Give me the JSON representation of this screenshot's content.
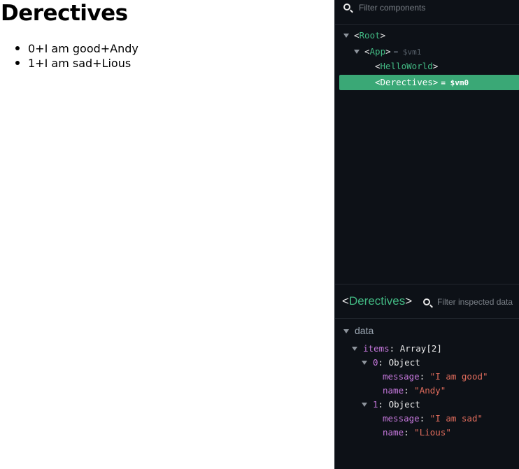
{
  "app": {
    "heading": "Derectives",
    "items": [
      {
        "text": "0+I am good+Andy"
      },
      {
        "text": "1+I am sad+Lious"
      }
    ]
  },
  "devtools": {
    "component_filter_placeholder": "Filter components",
    "tree": [
      {
        "name": "Root",
        "depth": 0,
        "expanded": true,
        "vm_ref": "",
        "selected": false
      },
      {
        "name": "App",
        "depth": 1,
        "expanded": true,
        "vm_ref": "= $vm1",
        "selected": false
      },
      {
        "name": "HelloWorld",
        "depth": 2,
        "expanded": false,
        "vm_ref": "",
        "selected": false
      },
      {
        "name": "Derectives",
        "depth": 2,
        "expanded": false,
        "vm_ref": "= $vm0",
        "selected": true
      }
    ],
    "inspector": {
      "component_name": "Derectives",
      "filter_placeholder": "Filter inspected data",
      "section": "data",
      "items_key": "items",
      "items_type": "Array[2]",
      "entries": [
        {
          "index": "0",
          "type": "Object",
          "message": "\"I am good\"",
          "name": "\"Andy\""
        },
        {
          "index": "1",
          "type": "Object",
          "message": "\"I am sad\"",
          "name": "\"Lious\""
        }
      ],
      "message_key": "message",
      "name_key": "name"
    }
  },
  "colors": {
    "vue_green": "#42b983",
    "selected_row": "#3aa876",
    "panel_bg": "#0d1117",
    "string_value": "#e06c5c",
    "property_key": "#c678dd"
  },
  "icons": [
    "search-icon",
    "expand-arrow-icon"
  ]
}
